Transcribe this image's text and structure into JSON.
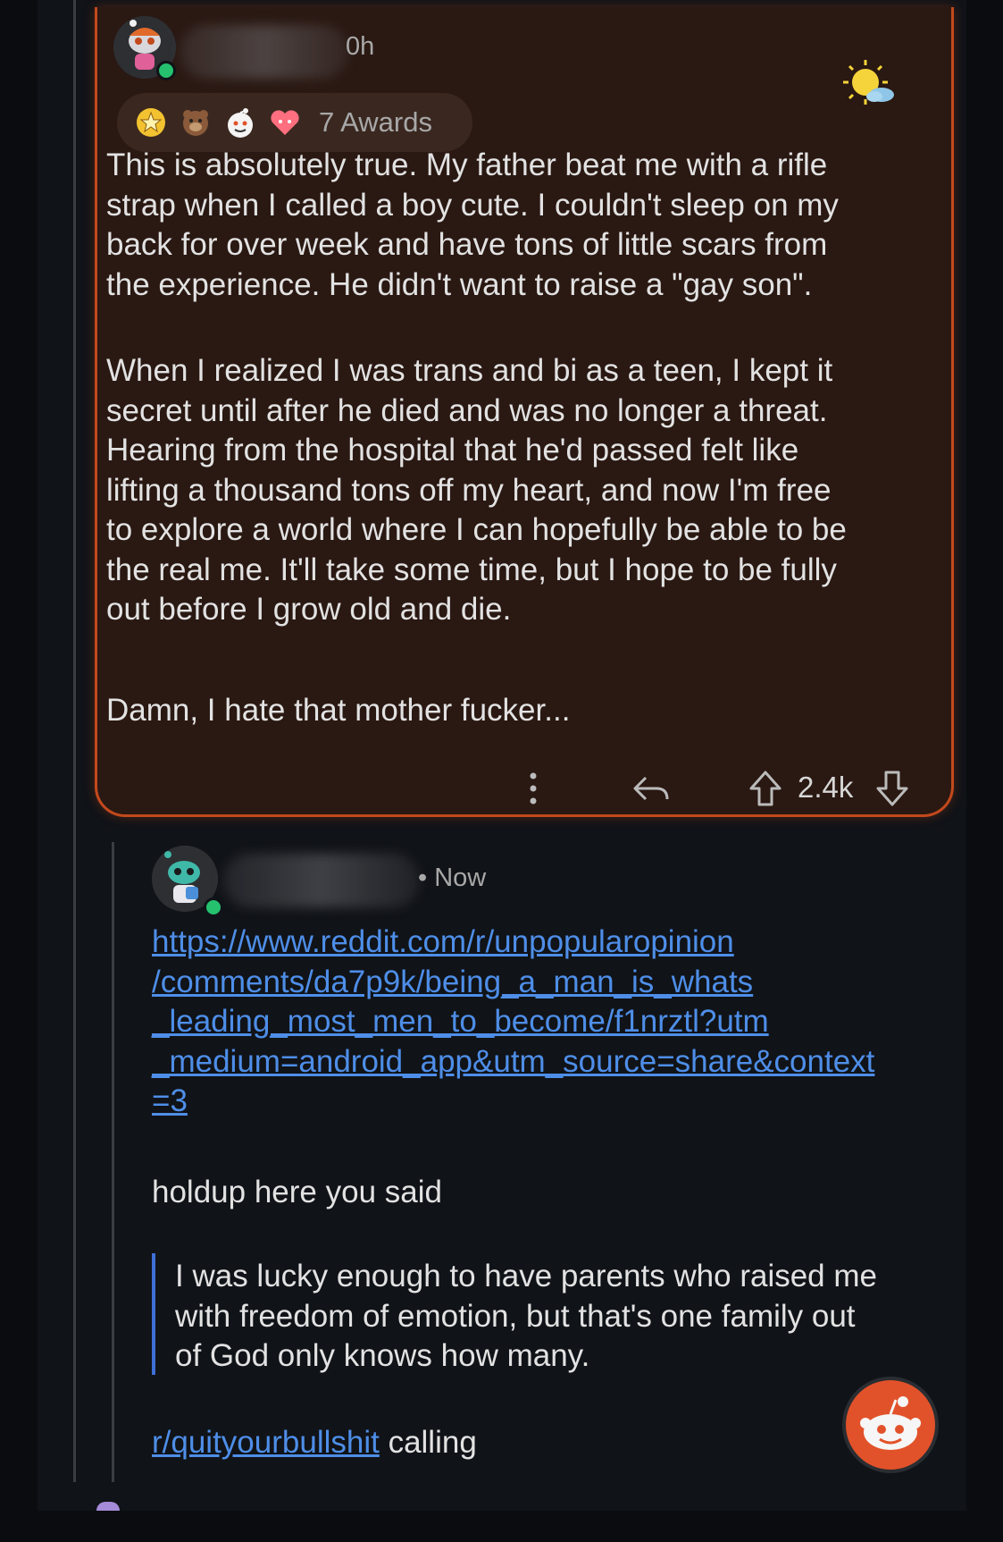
{
  "top_comment": {
    "timestamp": "0h",
    "awards_label": "7 Awards",
    "award_icons": [
      "star-award-icon",
      "bear-award-icon",
      "snoo-award-icon",
      "heart-award-icon"
    ],
    "paragraphs": [
      "This is absolutely true. My father beat me with a rifle\nstrap when I called a boy cute. I couldn't sleep on my\nback for over week and have tons of little scars from\nthe experience. He didn't want to raise a \"gay son\".",
      "When I realized I was trans and bi as a teen, I kept it\nsecret until after he died and was no longer a threat.\nHearing from the hospital that he'd passed felt like\nlifting a thousand tons off my heart, and now I'm free\nto explore a world where I can hopefully be able to be\nthe real me. It'll take some time, but I hope to be fully\nout before I grow old and die.",
      "Damn, I hate that mother fucker..."
    ],
    "vote_count": "2.4k"
  },
  "reply": {
    "timestamp": "• Now",
    "link_text": "https://www.reddit.com/r/unpopularopinion\n/comments/da7p9k/being_a_man_is_whats\n_leading_most_men_to_become/f1nrztl?utm\n_medium=android_app&utm_source=share&context\n=3",
    "intro": "holdup here you said",
    "quote": "I was lucky enough to have parents who raised me\nwith freedom of emotion, but that's one family out\nof God only knows how many.",
    "subreddit_link": "r/quityourbullshit",
    "closing": " calling"
  },
  "colors": {
    "accent_orange": "#c2491c",
    "link_blue": "#4e8ee8",
    "online_green": "#25c16f"
  }
}
